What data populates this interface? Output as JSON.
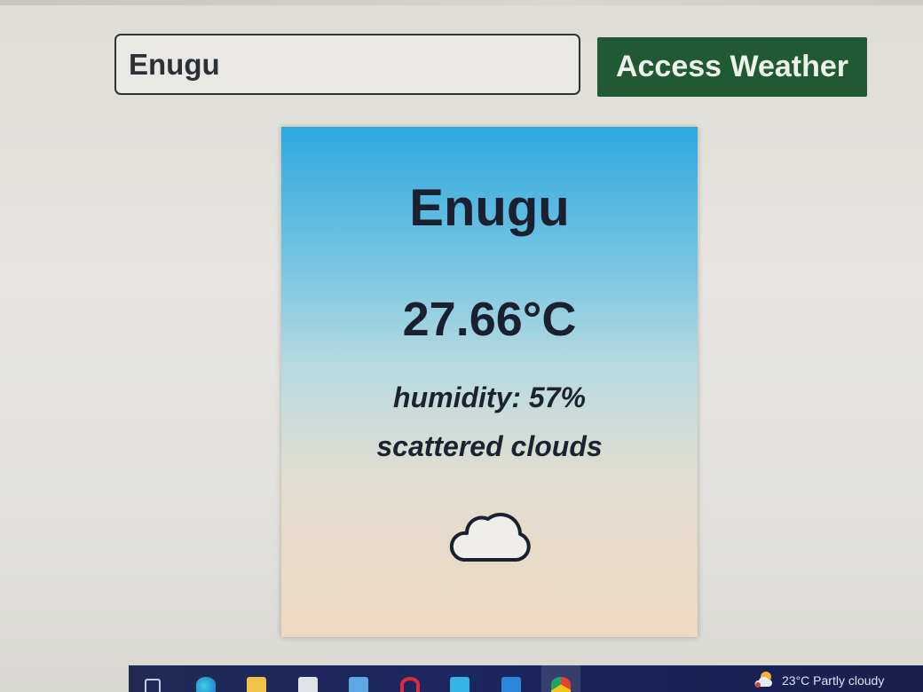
{
  "search": {
    "value": "Enugu"
  },
  "actions": {
    "access_label": "Access Weather"
  },
  "weather_card": {
    "city": "Enugu",
    "temperature": "27.66°C",
    "humidity": "humidity: 57%",
    "description": "scattered clouds",
    "icon": "cloud-icon"
  },
  "taskbar": {
    "apps": [
      "task-view-icon",
      "edge-icon",
      "file-explorer-icon",
      "store-icon",
      "mail-icon",
      "opera-icon",
      "photos-icon",
      "vscode-icon",
      "chrome-icon"
    ],
    "weather_widget": {
      "temp": "23°C",
      "condition": "Partly cloudy",
      "icon": "partly-cloudy-icon"
    }
  },
  "colors": {
    "button": "#1f5a32",
    "card_top": "#2da8df",
    "card_bottom": "#efd8c0",
    "text_dark": "#1a2030",
    "taskbar": "#1c2660"
  }
}
